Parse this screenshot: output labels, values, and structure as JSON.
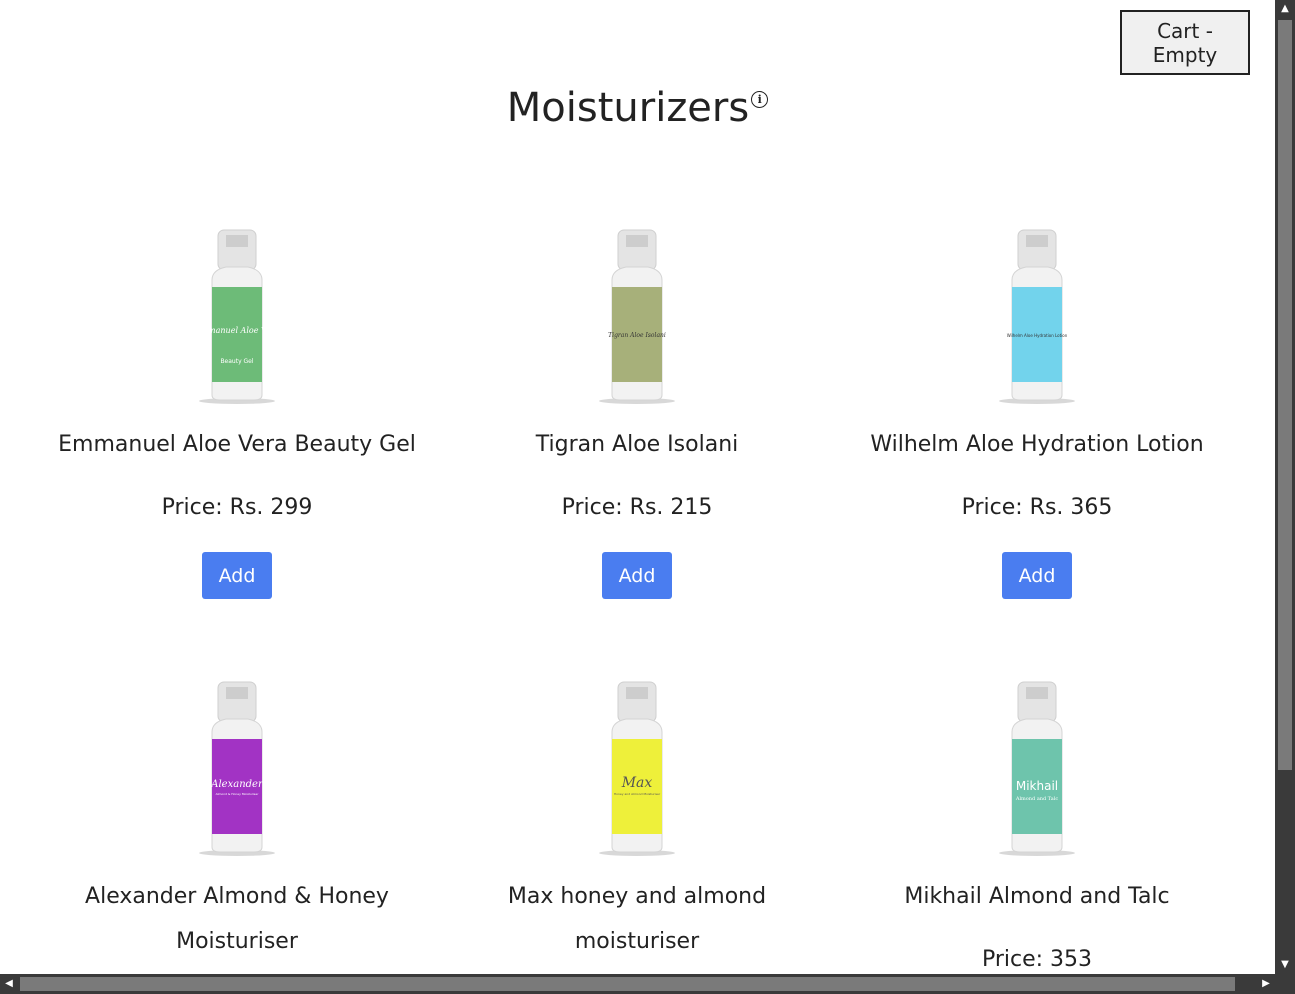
{
  "header": {
    "cart_label": "Cart - Empty",
    "title": "Moisturizers",
    "info_symbol": "i"
  },
  "products": [
    {
      "name": "Emmanuel Aloe Vera Beauty Gel",
      "name_line2": "",
      "price": "Price: Rs. 299",
      "add_label": "Add",
      "bottle_color": "#6dbb78",
      "label_text": "Emmanuel Aloe Vera",
      "label_sub": "Beauty Gel"
    },
    {
      "name": "Tigran Aloe Isolani",
      "name_line2": "",
      "price": "Price: Rs. 215",
      "add_label": "Add",
      "bottle_color": "#a7b07a",
      "label_text": "Tigran Aloe Isolani",
      "label_sub": ""
    },
    {
      "name": "Wilhelm Aloe Hydration Lotion",
      "name_line2": "",
      "price": "Price: Rs. 365",
      "add_label": "Add",
      "bottle_color": "#72d3ec",
      "label_text": "Wilhelm Aloe Hydration Lotion",
      "label_sub": ""
    },
    {
      "name": "Alexander Almond & Honey",
      "name_line2": "Moisturiser",
      "price": "",
      "add_label": "",
      "bottle_color": "#a233c4",
      "label_text": "Alexander",
      "label_sub": "Almond & Honey Moisturiser"
    },
    {
      "name": "Max honey and almond",
      "name_line2": "moisturiser",
      "price": "",
      "add_label": "",
      "bottle_color": "#eef03a",
      "label_text": "Max",
      "label_sub": "Honey and Almond Moisturiser"
    },
    {
      "name": "Mikhail Almond and Talc",
      "name_line2": "",
      "price": "Price: 353",
      "add_label": "",
      "bottle_color": "#6ec4ac",
      "label_text": "Mikhail",
      "label_sub": "Almond and Talc"
    }
  ]
}
